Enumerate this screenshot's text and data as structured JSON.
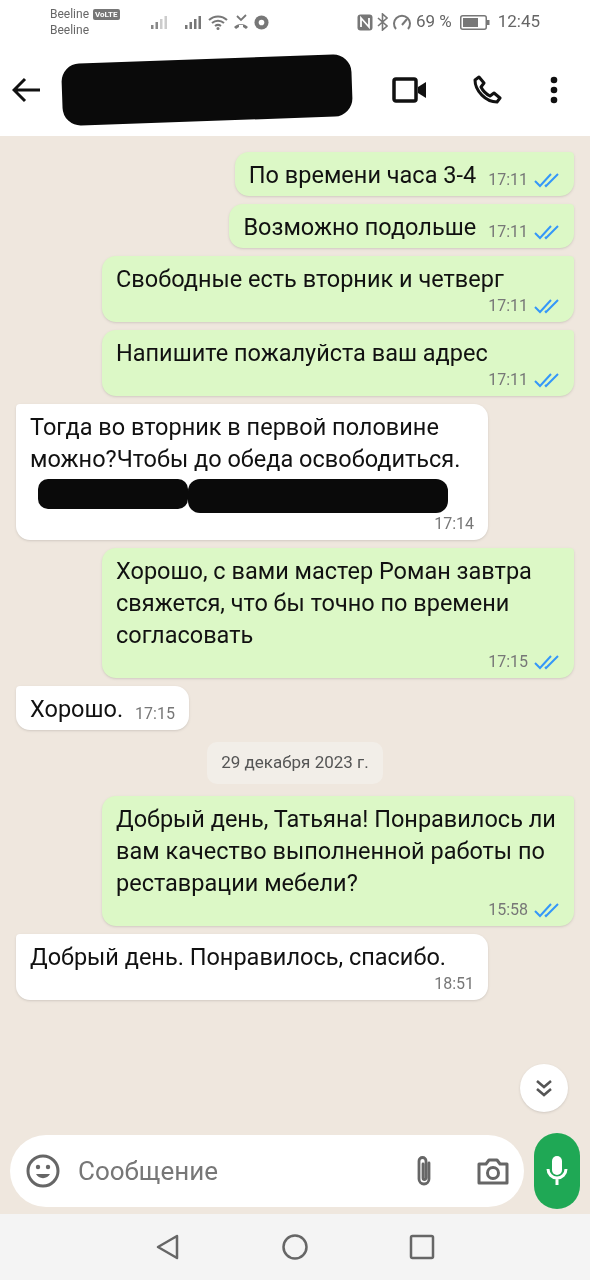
{
  "status_bar": {
    "carrier_1": "Beeline",
    "volte": "VoLTE",
    "carrier_2": "Beeline",
    "battery": "69 %",
    "time": "12:45"
  },
  "header": {
    "contact_redacted": true
  },
  "messages": [
    {
      "kind": "out",
      "text": "По времени часа 3-4",
      "time": "17:11",
      "read": true
    },
    {
      "kind": "out",
      "text": "Возможно подольше",
      "time": "17:11",
      "read": true
    },
    {
      "kind": "out",
      "text": "Свободные есть вторник и четверг",
      "time": "17:11",
      "read": true
    },
    {
      "kind": "out",
      "text": "Напишите пожалуйста ваш адрес",
      "time": "17:11",
      "read": true
    },
    {
      "kind": "in",
      "text": "Тогда во вторник в первой половине можно?Чтобы до обеда освободиться.",
      "time": "17:14",
      "redacted": true
    },
    {
      "kind": "out",
      "text": "Хорошо, с вами мастер Роман завтра свяжется, что бы точно по времени согласовать",
      "time": "17:15",
      "read": true
    },
    {
      "kind": "in",
      "text": "Хорошо.",
      "time": "17:15",
      "redacted": false
    },
    {
      "kind": "date",
      "text": "29 декабря 2023 г."
    },
    {
      "kind": "out",
      "text": "Добрый день, Татьяна! Понравилось ли вам качество выполненной работы по реставрации мебели?",
      "time": "15:58",
      "read": true
    },
    {
      "kind": "in",
      "text": "Добрый день. Понравилось, спасибо.",
      "time": "18:51",
      "redacted": false
    }
  ],
  "composer": {
    "placeholder": "Сообщение"
  }
}
